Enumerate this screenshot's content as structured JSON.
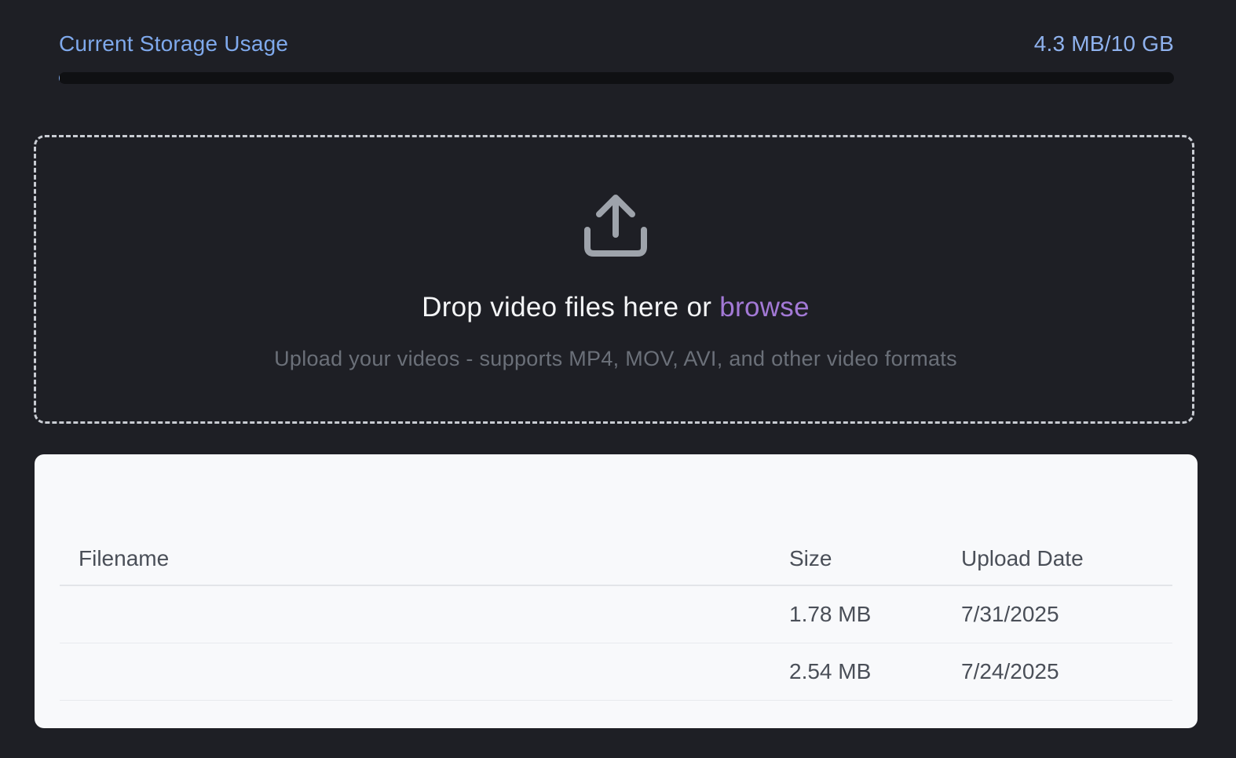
{
  "storage": {
    "label": "Current Storage Usage",
    "value": "4.3 MB/10 GB",
    "fill_fraction": 0.0004,
    "accent_color": "#7fa9ec"
  },
  "dropzone": {
    "icon": "upload-icon",
    "title_prefix": "Drop video files here or ",
    "browse_label": "browse",
    "browse_color": "#a379d6",
    "subtitle": "Upload your videos - supports MP4, MOV, AVI, and other video formats"
  },
  "table": {
    "columns": [
      "Filename",
      "Size",
      "Upload Date"
    ],
    "rows": [
      {
        "filename": "",
        "size": "1.78 MB",
        "date": "7/31/2025"
      },
      {
        "filename": "",
        "size": "2.54 MB",
        "date": "7/24/2025"
      }
    ]
  }
}
